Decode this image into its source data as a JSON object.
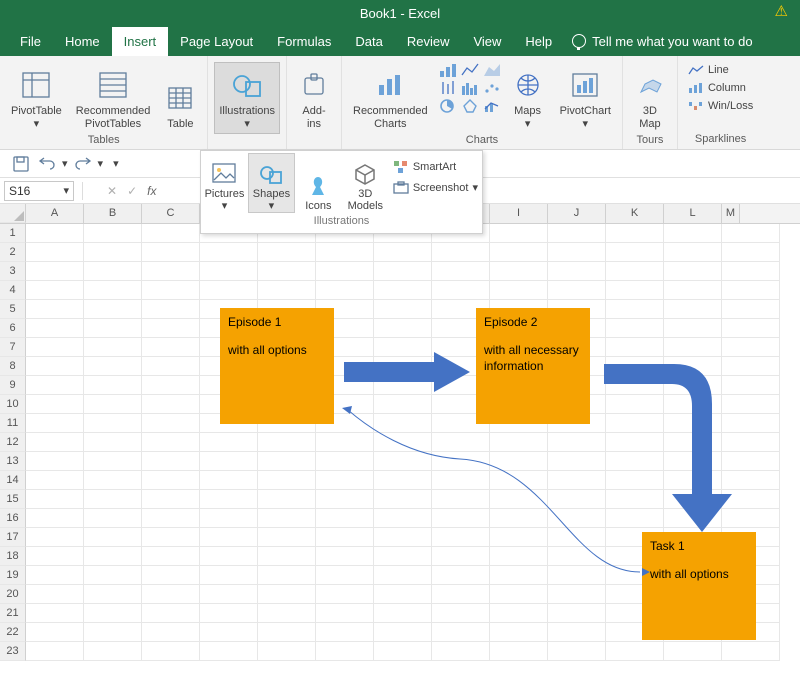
{
  "title": "Book1  -  Excel",
  "tabs": [
    "File",
    "Home",
    "Insert",
    "Page Layout",
    "Formulas",
    "Data",
    "Review",
    "View",
    "Help"
  ],
  "active_tab": "Insert",
  "tellme": "Tell me what you want to do",
  "ribbon": {
    "tables": {
      "label": "Tables",
      "pivot": "PivotTable",
      "recpivot": "Recommended\nPivotTables",
      "table": "Table"
    },
    "illus": {
      "label": "Illustrations",
      "btn": "Illustrations"
    },
    "addins": {
      "label": "Add-\nins"
    },
    "charts": {
      "label": "Charts",
      "rec": "Recommended\nCharts",
      "maps": "Maps",
      "pivotchart": "PivotChart"
    },
    "tours": {
      "label": "Tours",
      "map": "3D\nMap"
    },
    "spark": {
      "label": "Sparklines",
      "line": "Line",
      "col": "Column",
      "winloss": "Win/Loss"
    }
  },
  "illus_gallery": {
    "label": "Illustrations",
    "pictures": "Pictures",
    "shapes": "Shapes",
    "icons": "Icons",
    "models": "3D\nModels",
    "smartart": "SmartArt",
    "screenshot": "Screenshot"
  },
  "namebox": "S16",
  "shapes": {
    "ep1": {
      "title": "Episode 1",
      "body": "with all options"
    },
    "ep2": {
      "title": "Episode 2",
      "body": "with all necessary information"
    },
    "task": {
      "title": "Task 1",
      "body": "with all options"
    }
  },
  "colors": {
    "excel_green": "#217346",
    "shape_fill": "#f5a201",
    "arrow": "#4472c4"
  }
}
